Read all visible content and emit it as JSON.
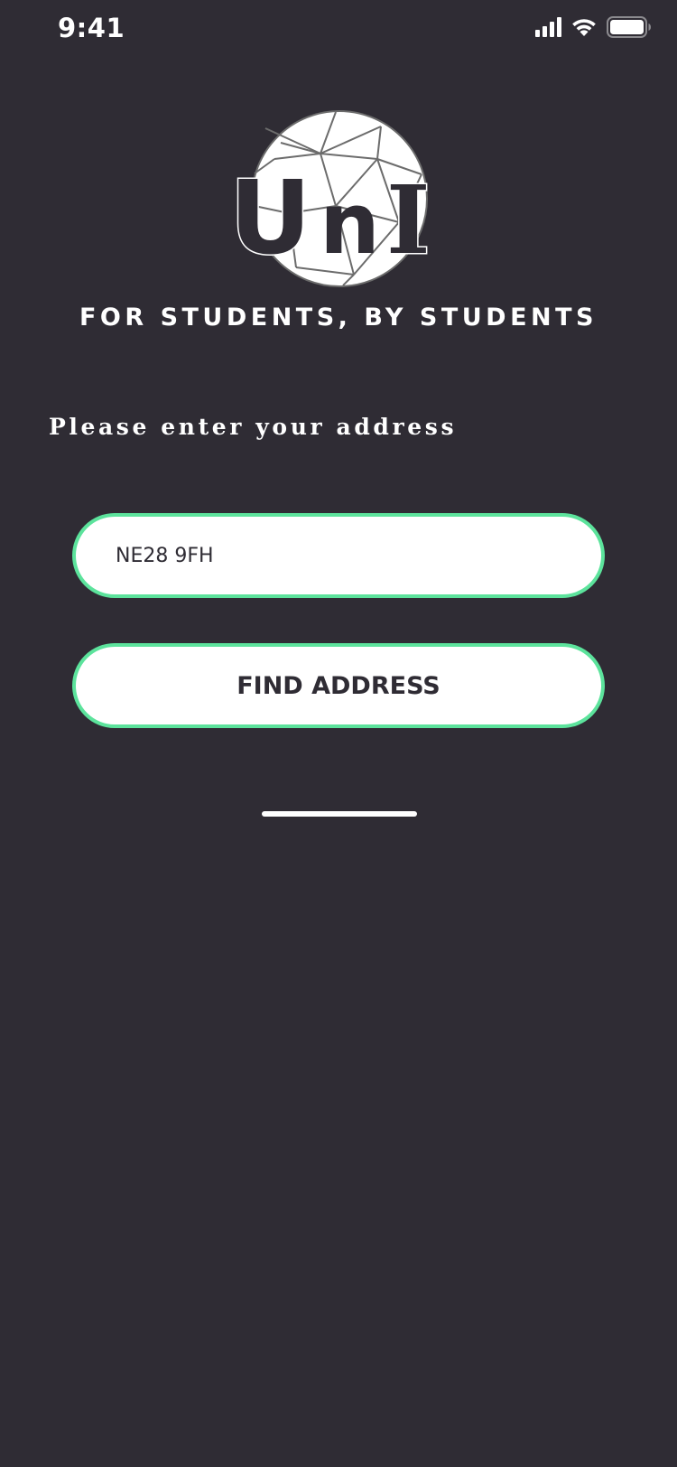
{
  "status_bar": {
    "time": "9:41",
    "icons": [
      "signal-icon",
      "wifi-icon",
      "battery-icon"
    ]
  },
  "logo": {
    "text": "UnI",
    "icon": "geodesic-globe-logo"
  },
  "tagline": "FOR STUDENTS, BY STUDENTS",
  "prompt": "Please enter your address",
  "address_input": {
    "value": "NE28 9FH",
    "placeholder": ""
  },
  "find_button": {
    "label": "FIND ADDRESS"
  },
  "colors": {
    "background": "#2f2c34",
    "accent": "#5ce39c",
    "text_dark": "#2f2c34",
    "text_light": "#ffffff"
  }
}
